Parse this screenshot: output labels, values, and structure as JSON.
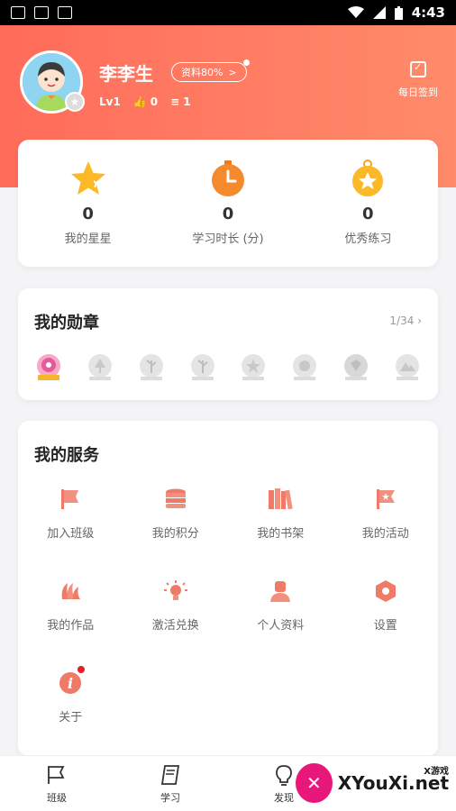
{
  "status_bar": {
    "time": "4:43"
  },
  "header": {
    "username": "李李生",
    "profile_pill": "资料80%",
    "profile_arrow": ">",
    "level": "Lv1",
    "likes": "0",
    "coins": "1",
    "checkin_label": "每日签到",
    "colors": {
      "gradient_start": "#ff6c5a",
      "gradient_end": "#ff8b6a"
    }
  },
  "stats": [
    {
      "value": "0",
      "label": "我的星星",
      "icon": "star-icon"
    },
    {
      "value": "0",
      "label": "学习时长 (分)",
      "icon": "stopwatch-icon"
    },
    {
      "value": "0",
      "label": "优秀练习",
      "icon": "medal-icon"
    }
  ],
  "badges": {
    "title": "我的勋章",
    "count": "1/34",
    "items": [
      "flower-badge",
      "tree-badge",
      "tree-badge",
      "tree-badge",
      "star-badge",
      "leaf-badge",
      "diamond-badge",
      "mountain-badge"
    ]
  },
  "services": {
    "title": "我的服务",
    "items": [
      {
        "label": "加入班级",
        "icon": "flag-icon"
      },
      {
        "label": "我的积分",
        "icon": "coin-stack-icon"
      },
      {
        "label": "我的书架",
        "icon": "bookshelf-icon"
      },
      {
        "label": "我的活动",
        "icon": "star-flag-icon"
      },
      {
        "label": "我的作品",
        "icon": "works-icon"
      },
      {
        "label": "激活兑换",
        "icon": "lightbulb-icon"
      },
      {
        "label": "个人资料",
        "icon": "person-icon"
      },
      {
        "label": "设置",
        "icon": "settings-icon"
      },
      {
        "label": "关于",
        "icon": "info-icon"
      }
    ]
  },
  "bottom_nav": [
    {
      "label": "班级",
      "icon": "class-flag-icon"
    },
    {
      "label": "学习",
      "icon": "book-icon"
    },
    {
      "label": "发现",
      "icon": "lightbulb-outline-icon"
    }
  ],
  "watermark": {
    "text": "XYouXi.net",
    "small": "X游戏"
  },
  "accent_color": "#f0705c"
}
